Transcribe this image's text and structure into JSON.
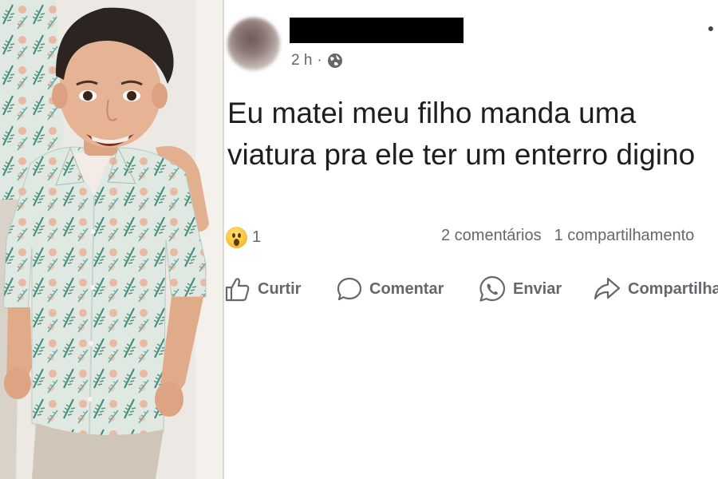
{
  "post": {
    "time": "2 h",
    "separator": "·",
    "text": "Eu matei meu filho manda uma viatura pra ele ter um enterro digino",
    "reaction_count": "1",
    "comments": "2 comentários",
    "shares": "1 compartilhamento"
  },
  "actions": {
    "like": "Curtir",
    "comment": "Comentar",
    "send": "Enviar",
    "share": "Compartilhar"
  },
  "icons": {
    "privacy": "globe-icon",
    "reaction": "wow-emoji-icon",
    "like": "thumbs-up-icon",
    "comment": "speech-bubble-icon",
    "send": "whatsapp-icon",
    "share": "share-arrow-icon",
    "menu": "more-dots-icon"
  },
  "colors": {
    "secondary_text": "#65676b",
    "primary_text": "#1c1e21",
    "redaction": "#000000"
  }
}
